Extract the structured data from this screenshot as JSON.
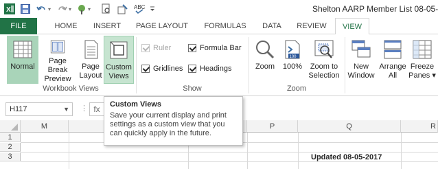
{
  "window": {
    "title": "Shelton AARP Member List 08-05-"
  },
  "qat": {
    "icons": [
      "excel-logo-icon",
      "save-icon",
      "undo-icon",
      "redo-icon",
      "paint-icon",
      "print-preview-icon",
      "touch-mode-icon",
      "spelling-icon",
      "customize-qat-icon"
    ]
  },
  "tabs": [
    "FILE",
    "HOME",
    "INSERT",
    "PAGE LAYOUT",
    "FORMULAS",
    "DATA",
    "REVIEW",
    "VIEW"
  ],
  "ribbon": {
    "workbook_views": {
      "label": "Workbook Views",
      "normal": [
        "Normal",
        ""
      ],
      "page_break": [
        "Page Break",
        "Preview"
      ],
      "page_layout": [
        "Page",
        "Layout"
      ],
      "custom_views": [
        "Custom",
        "Views"
      ]
    },
    "show": {
      "label": "Show",
      "ruler": "Ruler",
      "formula_bar": "Formula Bar",
      "gridlines": "Gridlines",
      "headings": "Headings"
    },
    "zoom": {
      "label": "Zoom",
      "zoom": [
        "Zoom",
        ""
      ],
      "hundred": [
        "100%",
        ""
      ],
      "hundred_badge": "100",
      "zoom_to_selection": [
        "Zoom to",
        "Selection"
      ]
    },
    "window": {
      "new_window": [
        "New",
        "Window"
      ],
      "arrange_all": [
        "Arrange",
        "All"
      ],
      "freeze_panes": [
        "Freeze",
        "Panes ▾"
      ]
    }
  },
  "formula_bar": {
    "name_box": "H117",
    "fx": "fx"
  },
  "tooltip": {
    "title": "Custom Views",
    "body": "Save your current display and print settings as a custom view that you can quickly apply in the future."
  },
  "grid": {
    "columns": [
      "M",
      "P",
      "Q",
      "R"
    ],
    "rows": [
      "1",
      "2",
      "3"
    ],
    "cell_q3": "Updated 08-05-2017"
  },
  "colors": {
    "file_tab": "#217346",
    "selected_view": "#a9d4b9",
    "hover_view": "#c6e4d0"
  }
}
